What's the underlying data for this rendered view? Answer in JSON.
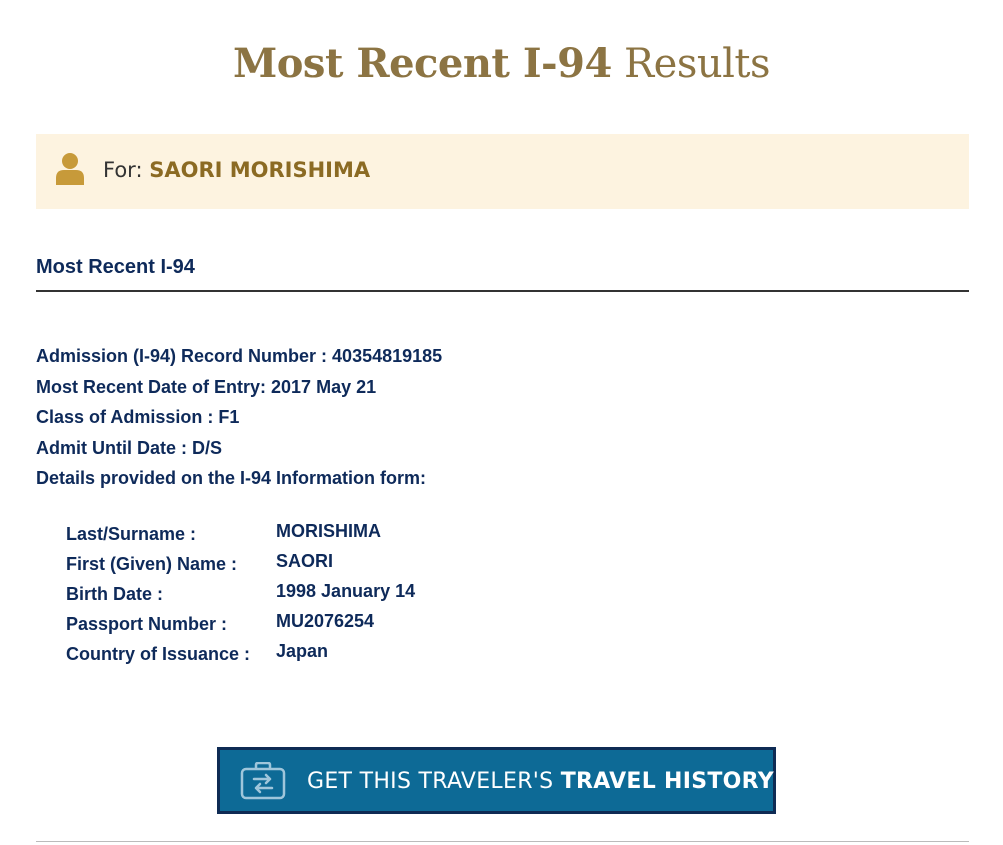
{
  "page_title": {
    "strong": "Most Recent I-94",
    "light": "Results"
  },
  "for_banner": {
    "prefix": "For:",
    "name": "SAORI MORISHIMA"
  },
  "section_heading": "Most Recent I-94",
  "summary": {
    "record_number": "Admission (I-94) Record Number : 40354819185",
    "entry_date": "Most Recent Date of Entry: 2017 May 21",
    "class_of_admission": "Class of Admission : F1",
    "admit_until": "Admit Until Date : D/S",
    "details_intro": "Details provided on the I-94 Information form:"
  },
  "details": [
    {
      "label": "Last/Surname :",
      "value": "MORISHIMA"
    },
    {
      "label": "First (Given) Name :",
      "value": "SAORI"
    },
    {
      "label": "Birth Date :",
      "value": "1998 January 14"
    },
    {
      "label": "Passport Number :",
      "value": "MU2076254"
    },
    {
      "label": "Country of Issuance :",
      "value": "Japan"
    }
  ],
  "history_button": {
    "prefix": "GET THIS TRAVELER'S ",
    "strong": "TRAVEL HISTORY"
  },
  "colors": {
    "title": "#8c7443",
    "banner_bg": "#fdf3e0",
    "name_gold": "#8b6a23",
    "navy_text": "#0e2a5a",
    "button_bg": "#0d6a96",
    "button_border": "#0f2b54"
  },
  "icons": {
    "banner": "person-icon",
    "button": "suitcase-arrows-icon"
  }
}
